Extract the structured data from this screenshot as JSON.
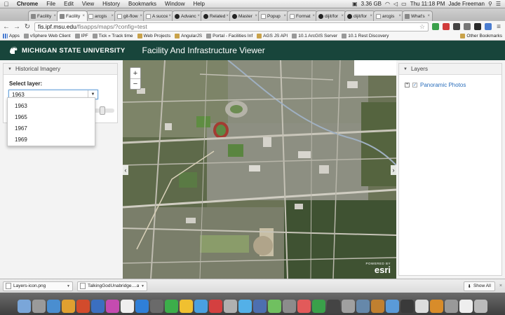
{
  "menubar": {
    "apple": "",
    "app_name": "Chrome",
    "items": [
      "File",
      "Edit",
      "View",
      "History",
      "Bookmarks",
      "Window",
      "Help"
    ],
    "memory": "3.36 GB",
    "clock": "Thu 11:18 PM",
    "user": "Jade Freeman"
  },
  "tabs": [
    {
      "title": "Facility",
      "icon": "page-icon"
    },
    {
      "title": "Facility",
      "icon": "page-icon",
      "active": true
    },
    {
      "title": "arcgis",
      "icon": "doc-icon"
    },
    {
      "title": "git-flow",
      "icon": "doc-icon"
    },
    {
      "title": "A succe",
      "icon": "doc-icon"
    },
    {
      "title": "Advanc",
      "icon": "github-icon"
    },
    {
      "title": "Related",
      "icon": "github-icon"
    },
    {
      "title": "Master",
      "icon": "github-icon"
    },
    {
      "title": "Popup",
      "icon": "doc-icon"
    },
    {
      "title": "Format",
      "icon": "doc-icon"
    },
    {
      "title": "dijit/for",
      "icon": "github-icon"
    },
    {
      "title": "dijit/for",
      "icon": "github-icon"
    },
    {
      "title": "arcgis",
      "icon": "doc-icon"
    },
    {
      "title": "What's",
      "icon": "page-icon"
    }
  ],
  "omnibox": {
    "host": "fis.ipf.msu.edu",
    "path": "/fisapps/maps/?config=test"
  },
  "bookmarks": [
    {
      "label": "Apps",
      "icon": "grid"
    },
    {
      "label": "vSphere Web Client",
      "icon": "page"
    },
    {
      "label": "IPF",
      "icon": "page"
    },
    {
      "label": "Tick » Track time",
      "icon": "page"
    },
    {
      "label": "Web Projects",
      "icon": "folder"
    },
    {
      "label": "AngularJS",
      "icon": "folder"
    },
    {
      "label": "Portal - Facilities Inf",
      "icon": "page"
    },
    {
      "label": "AGS JS API",
      "icon": "folder"
    },
    {
      "label": "10.1 ArcGIS Server",
      "icon": "page"
    },
    {
      "label": "10.1 Rest Discovery",
      "icon": "page"
    }
  ],
  "other_bookmarks": "Other Bookmarks",
  "header": {
    "university": "MICHIGAN STATE UNIVERSITY",
    "title": "Facility And Infrastructure Viewer",
    "bg_color": "#18453b"
  },
  "historical_panel": {
    "title": "Historical Imagery",
    "select_label": "Select layer:",
    "select_value": "1963",
    "options": [
      "1963",
      "1965",
      "1967",
      "1969"
    ]
  },
  "map": {
    "zoom_in": "+",
    "zoom_out": "−",
    "attribution_small": "POWERED BY",
    "attribution": "esri"
  },
  "layers_panel": {
    "title": "Layers",
    "items": [
      {
        "label": "Panoramic Photos",
        "checked": true
      }
    ]
  },
  "downloads": [
    {
      "name": "Layers-icon.png"
    },
    {
      "name": "TalkingGodUnabridge....aax"
    }
  ],
  "show_all": "Show All",
  "dock_colors": [
    "#7aa6d9",
    "#9a9a9a",
    "#4a8ed0",
    "#e0a030",
    "#d24b2c",
    "#3b6fc0",
    "#c54bb0",
    "#efefef",
    "#2f7fd8",
    "#6a6a6a",
    "#3cae4a",
    "#f0c030",
    "#4aa0e0",
    "#d44040",
    "#b0b0b0",
    "#53b0e8",
    "#4d6fb0",
    "#70c060",
    "#8c8c8c",
    "#e25a5a",
    "#3aa04a",
    "#444444",
    "#a0a0a0",
    "#6688aa",
    "#c08030",
    "#5a9ad8",
    "#3a3a3a",
    "#dddddd",
    "#d88c2a",
    "#999999",
    "#eeeeee",
    "#bbbbbb"
  ]
}
